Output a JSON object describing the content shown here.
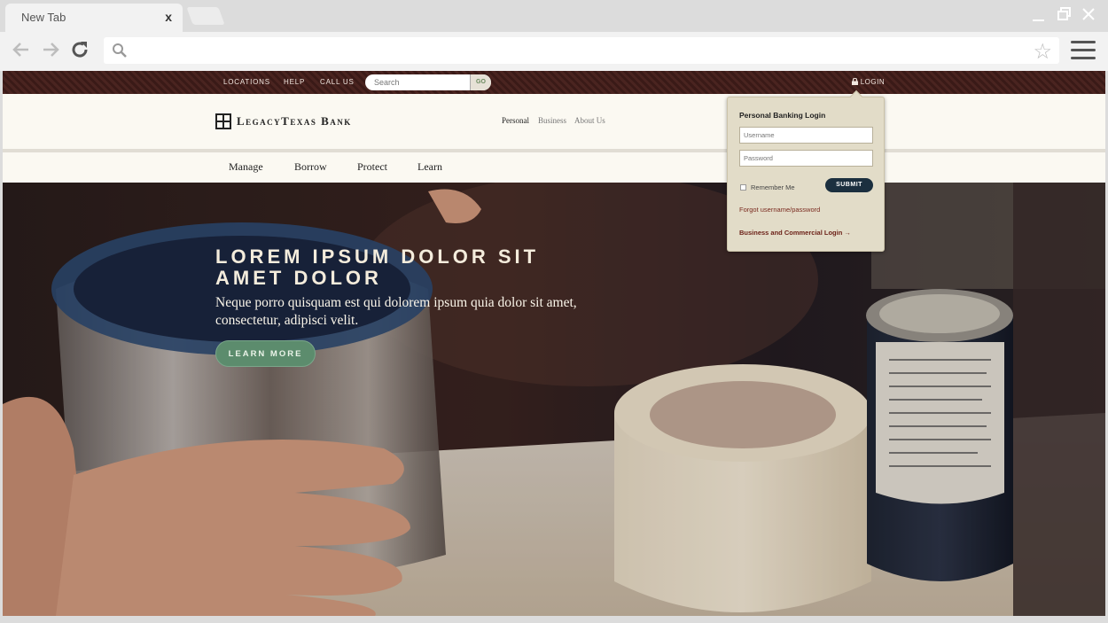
{
  "browser": {
    "tab_title": "New Tab",
    "tab_close": "x",
    "search_placeholder": ""
  },
  "utility_nav": {
    "links": [
      "LOCATIONS",
      "HELP",
      "CALL US"
    ],
    "search_placeholder": "Search",
    "search_button": "GO",
    "login_label": "LOGIN"
  },
  "header": {
    "logo_text": "LegacyTexas Bank",
    "segments": [
      "Personal",
      "Business",
      "About Us"
    ],
    "active_segment": "Personal"
  },
  "main_nav": [
    "Manage",
    "Borrow",
    "Protect",
    "Learn"
  ],
  "hero": {
    "title": "LOREM IPSUM DOLOR SIT AMET DOLOR",
    "body": "Neque porro quisquam est qui dolorem ipsum quia dolor sit amet, consectetur, adipisci velit.",
    "cta": "LEARN MORE"
  },
  "login_popover": {
    "title": "Personal Banking Login",
    "username_placeholder": "Username",
    "password_placeholder": "Password",
    "remember_label": "Remember Me",
    "submit_label": "SUBMIT",
    "forgot_link": "Forgot username/password",
    "business_link": "Business and Commercial Login →"
  },
  "colors": {
    "utility_bar": "#3f1d1a",
    "header_bg": "#fbf9f2",
    "hero_button": "#5c8c6d",
    "submit_button": "#1b2f3f",
    "link_red": "#7a2a1f"
  }
}
